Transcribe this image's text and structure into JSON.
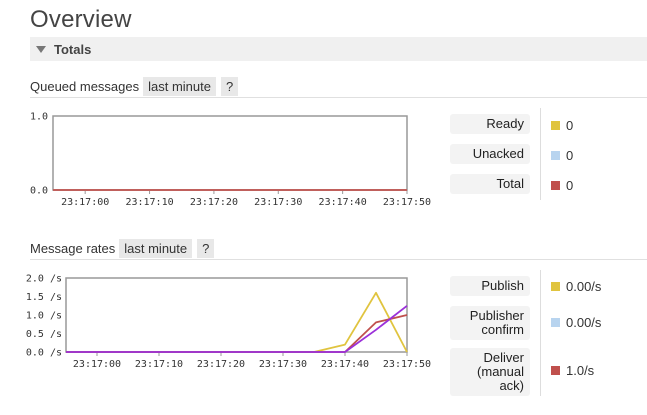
{
  "page": {
    "title": "Overview"
  },
  "totals": {
    "label": "Totals"
  },
  "queued": {
    "title": "Queued messages",
    "range_label": "last minute",
    "help_label": "?",
    "legend": [
      {
        "label": "Ready",
        "value": "0",
        "color": "#e0c43f"
      },
      {
        "label": "Unacked",
        "value": "0",
        "color": "#b8d4ef"
      },
      {
        "label": "Total",
        "value": "0",
        "color": "#c0504d"
      }
    ]
  },
  "rates": {
    "title": "Message rates",
    "range_label": "last minute",
    "help_label": "?",
    "legend": [
      {
        "label": "Publish",
        "value": "0.00/s",
        "color": "#e0c43f"
      },
      {
        "label": "Publisher confirm",
        "value": "0.00/s",
        "color": "#b8d4ef"
      },
      {
        "label": "Deliver (manual ack)",
        "value": "1.0/s",
        "color": "#c0504d"
      }
    ]
  },
  "chart_data": [
    {
      "type": "line",
      "x_ticks": [
        "23:17:00",
        "23:17:10",
        "23:17:20",
        "23:17:30",
        "23:17:40",
        "23:17:50"
      ],
      "y_ticks": [
        "0.0",
        "1.0"
      ],
      "ylim": [
        0,
        1
      ],
      "x": [
        "23:16:55",
        "23:17:50"
      ],
      "series": [
        {
          "name": "Ready",
          "color": "#e0c43f",
          "values": [
            0,
            0
          ]
        },
        {
          "name": "Unacked",
          "color": "#b8d4ef",
          "values": [
            0,
            0
          ]
        },
        {
          "name": "Total",
          "color": "#c0504d",
          "values": [
            0,
            0
          ]
        }
      ]
    },
    {
      "type": "line",
      "x_ticks": [
        "23:17:00",
        "23:17:10",
        "23:17:20",
        "23:17:30",
        "23:17:40",
        "23:17:50"
      ],
      "y_ticks": [
        "0.0 /s",
        "0.5 /s",
        "1.0 /s",
        "1.5 /s",
        "2.0 /s"
      ],
      "ylim": [
        0,
        2
      ],
      "x": [
        "23:16:55",
        "23:17:35",
        "23:17:40",
        "23:17:45",
        "23:17:50"
      ],
      "series": [
        {
          "name": "Publish",
          "color": "#e0c43f",
          "values": [
            0,
            0,
            0.2,
            1.6,
            0
          ]
        },
        {
          "name": "Deliver (manual ack)",
          "color": "#c0504d",
          "values": [
            0,
            0,
            0,
            0.8,
            1.0
          ]
        },
        {
          "color": "#9b30d9",
          "values": [
            0,
            0,
            0,
            0.6,
            1.25
          ]
        }
      ]
    }
  ]
}
